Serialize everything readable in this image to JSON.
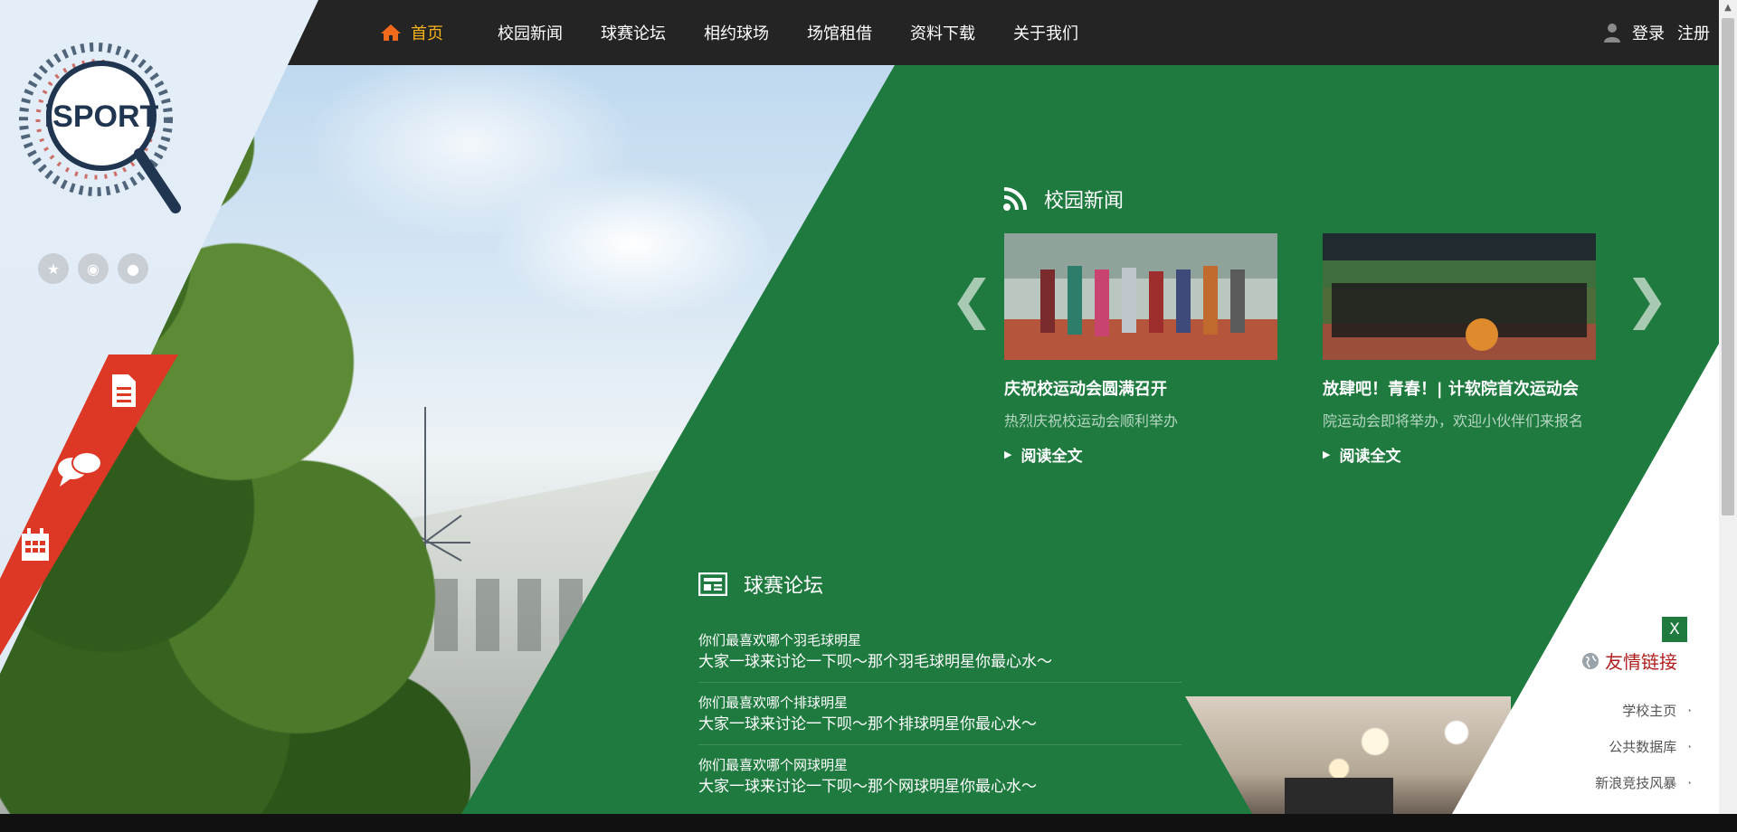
{
  "nav": {
    "home": "首页",
    "items": [
      "校园新闻",
      "球赛论坛",
      "相约球场",
      "场馆租借",
      "资料下载",
      "关于我们"
    ]
  },
  "auth": {
    "login": "登录",
    "register": "注册"
  },
  "logo": {
    "text": "iSPORT"
  },
  "news": {
    "heading": "校园新闻",
    "cards": [
      {
        "title": "庆祝校运动会圆满召开",
        "desc": "热烈庆祝校运动会顺利举办",
        "more": "阅读全文"
      },
      {
        "title": "放肆吧！青春！| 计软院首次运动会",
        "desc": "院运动会即将举办，欢迎小伙伴们来报名",
        "more": "阅读全文"
      }
    ],
    "prev": "❮",
    "next": "❯"
  },
  "forum": {
    "heading": "球赛论坛",
    "items": [
      {
        "q": "你们最喜欢哪个羽毛球明星",
        "a": "大家一球来讨论一下呗～那个羽毛球明星你最心水～"
      },
      {
        "q": "你们最喜欢哪个排球明星",
        "a": "大家一球来讨论一下呗～那个排球明星你最心水～"
      },
      {
        "q": "你们最喜欢哪个网球明星",
        "a": "大家一球来讨论一下呗～那个网球明星你最心水～"
      }
    ]
  },
  "friends": {
    "close": "X",
    "title": "友情链接",
    "links": [
      "学校主页",
      "公共数据库",
      "新浪竞技风暴"
    ],
    "dot": "·"
  },
  "colors": {
    "green": "#1f7a3f",
    "red": "#dd3826",
    "nav_active": "#f7b21a",
    "topbar": "#242424"
  }
}
